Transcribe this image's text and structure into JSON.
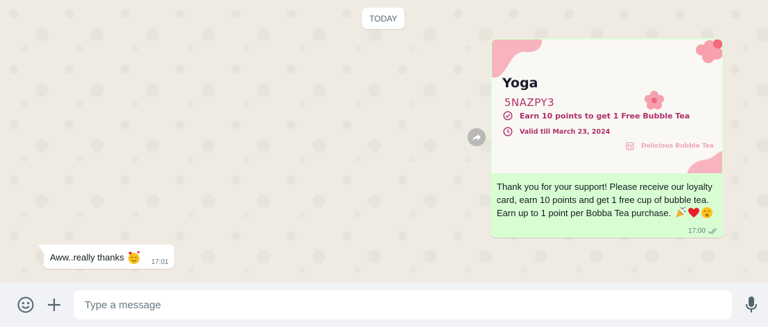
{
  "chat": {
    "date_chip": "TODAY",
    "outgoing": {
      "card": {
        "title": "Yoga",
        "code": "5NAZPY3",
        "points_text": "Earn 10 points to get 1 Free Bubble Tea",
        "valid_text": "Valid till March 23, 2024",
        "shop_name": "Delicious Bubble Tea"
      },
      "text": "Thank you for your support! Please receive our loyalty card, earn 10 points and get 1 free cup of bubble tea. Earn up to 1 point per Bobba Tea purchase.",
      "emojis": [
        "party-popper-emoji",
        "red-heart-emoji",
        "kissing-face-emoji"
      ],
      "time": "17:00",
      "status": "double-check-icon"
    },
    "incoming": {
      "text": "Aww..really thanks",
      "emoji": "smiling-face-with-hearts-emoji",
      "time": "17:01"
    }
  },
  "composer": {
    "placeholder": "Type a message",
    "value": ""
  },
  "colors": {
    "outgoing_bubble": "#d9fdd3",
    "incoming_bubble": "#ffffff",
    "card_accent": "#b0306a",
    "card_blob": "#f8b4be",
    "background": "#efeae2"
  }
}
